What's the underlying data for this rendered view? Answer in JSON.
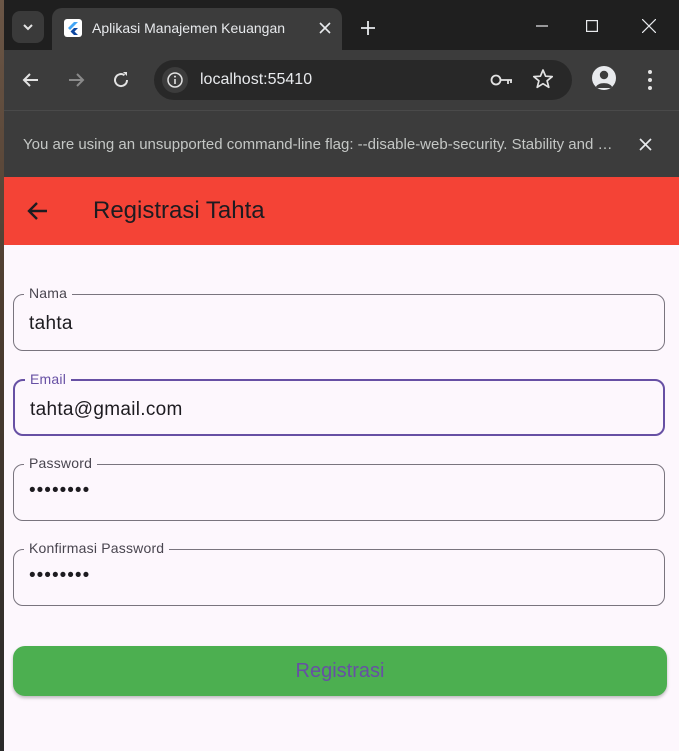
{
  "browser": {
    "tab_title": "Aplikasi Manajemen Keuangan",
    "url": "localhost:55410",
    "infobar_message": "You are using an unsupported command-line flag: --disable-web-security. Stability and security will suffer."
  },
  "app": {
    "title": "Registrasi Tahta",
    "accent_color": "#f44336",
    "fields": [
      {
        "label": "Nama",
        "value": "tahta"
      },
      {
        "label": "Email",
        "value": "tahta@gmail.com"
      },
      {
        "label": "Password",
        "value": "••••••••"
      },
      {
        "label": "Konfirmasi Password",
        "value": "••••••••"
      }
    ],
    "submit_label": "Registrasi"
  },
  "icons": {
    "tab_search": "chevron-down-icon",
    "tab_close": "close-icon",
    "new_tab": "plus-icon",
    "back": "arrow-left-icon",
    "forward": "arrow-right-icon",
    "reload": "reload-icon",
    "site_info": "info-icon",
    "password_key": "key-icon",
    "bookmark": "star-icon",
    "profile": "person-icon",
    "menu": "more-vert-icon"
  }
}
